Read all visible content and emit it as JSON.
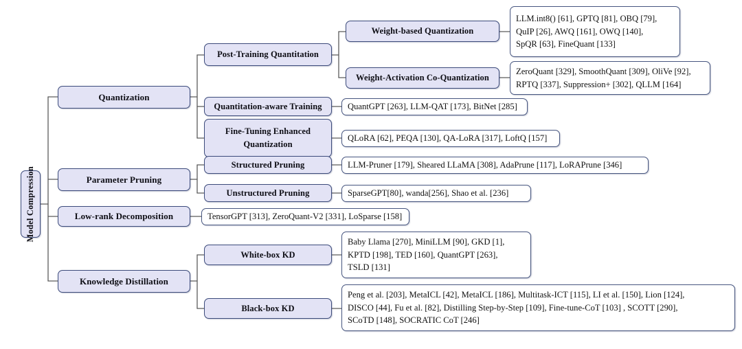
{
  "diagram": {
    "title": "Model Compression Taxonomy",
    "root": {
      "label": "Model Compression"
    },
    "colors": {
      "category_fill": "#e3e3f5",
      "category_border": "#3b4a7a",
      "leaf_fill": "#ffffff",
      "leaf_border": "#46557f",
      "edge": "#5a5a5a",
      "text": "#0d0d14",
      "background": "#ffffff"
    },
    "level2": [
      {
        "id": "quantization",
        "label": "Quantization"
      },
      {
        "id": "parameter-pruning",
        "label": "Parameter Pruning"
      },
      {
        "id": "low-rank-decomposition",
        "label": "Low-rank Decomposition"
      },
      {
        "id": "knowledge-distillation",
        "label": "Knowledge Distillation"
      }
    ],
    "level3": [
      {
        "id": "post-training-quantitation",
        "label": "Post-Training Quantitation"
      },
      {
        "id": "quantitation-aware-training",
        "label": "Quantitation-aware Training"
      },
      {
        "id": "fine-tuning-enhanced-quantization",
        "label_line1": "Fine-Tuning Enhanced",
        "label_line2": "Quantization"
      },
      {
        "id": "structured-pruning",
        "label": "Structured Pruning"
      },
      {
        "id": "unstructured-pruning",
        "label": "Unstructured Pruning"
      },
      {
        "id": "white-box-kd",
        "label": "White-box KD"
      },
      {
        "id": "black-box-kd",
        "label": "Black-box KD"
      }
    ],
    "level4": [
      {
        "id": "weight-based-quantization",
        "label": "Weight-based Quantization"
      },
      {
        "id": "weight-activation-co-quantization",
        "label": "Weight-Activation Co-Quantization"
      }
    ],
    "leaves": [
      {
        "id": "leaf-weight-based",
        "parent": "weight-based-quantization",
        "lines": [
          "LLM.int8() [61], GPTQ [81],  OBQ [79],",
          "QuIP [26], AWQ [161], OWQ [140],",
          "SpQR [63], FineQuant [133]"
        ]
      },
      {
        "id": "leaf-weight-activation",
        "parent": "weight-activation-co-quantization",
        "lines": [
          "ZeroQuant [329], SmoothQuant [309], OliVe [92],",
          "RPTQ [337], Suppression+ [302], QLLM [164]"
        ]
      },
      {
        "id": "leaf-qat",
        "parent": "quantitation-aware-training",
        "lines": [
          "QuantGPT [263], LLM-QAT [173], BitNet [285]"
        ]
      },
      {
        "id": "leaf-ftq",
        "parent": "fine-tuning-enhanced-quantization",
        "lines": [
          "QLoRA [62], PEQA [130],  QA-LoRA [317], LoftQ [157]"
        ]
      },
      {
        "id": "leaf-structured-pruning",
        "parent": "structured-pruning",
        "lines": [
          "LLM-Pruner [179], Sheared LLaMA [308], AdaPrune [117], LoRAPrune [346]"
        ]
      },
      {
        "id": "leaf-unstructured-pruning",
        "parent": "unstructured-pruning",
        "lines": [
          "SparseGPT[80], wanda[256], Shao et al. [236]"
        ]
      },
      {
        "id": "leaf-low-rank",
        "parent": "low-rank-decomposition",
        "lines": [
          "TensorGPT [313], ZeroQuant-V2 [331], LoSparse [158]"
        ]
      },
      {
        "id": "leaf-white-box-kd",
        "parent": "white-box-kd",
        "lines": [
          "Baby Llama [270], MiniLLM [90], GKD [1],",
          "KPTD [198], TED [160], QuantGPT [263],",
          "TSLD [131]"
        ]
      },
      {
        "id": "leaf-black-box-kd",
        "parent": "black-box-kd",
        "lines": [
          "Peng et al. [203], MetaICL [42], MetaICL [186],  Multitask-ICT [115], LI et al. [150], Lion [124],",
          "DISCO [44], Fu et al. [82],  Distilling Step-by-Step [109], Fine-tune-CoT [103] , SCOTT [290],",
          "SCoTD [148], SOCRATIC CoT [246]"
        ]
      }
    ]
  }
}
